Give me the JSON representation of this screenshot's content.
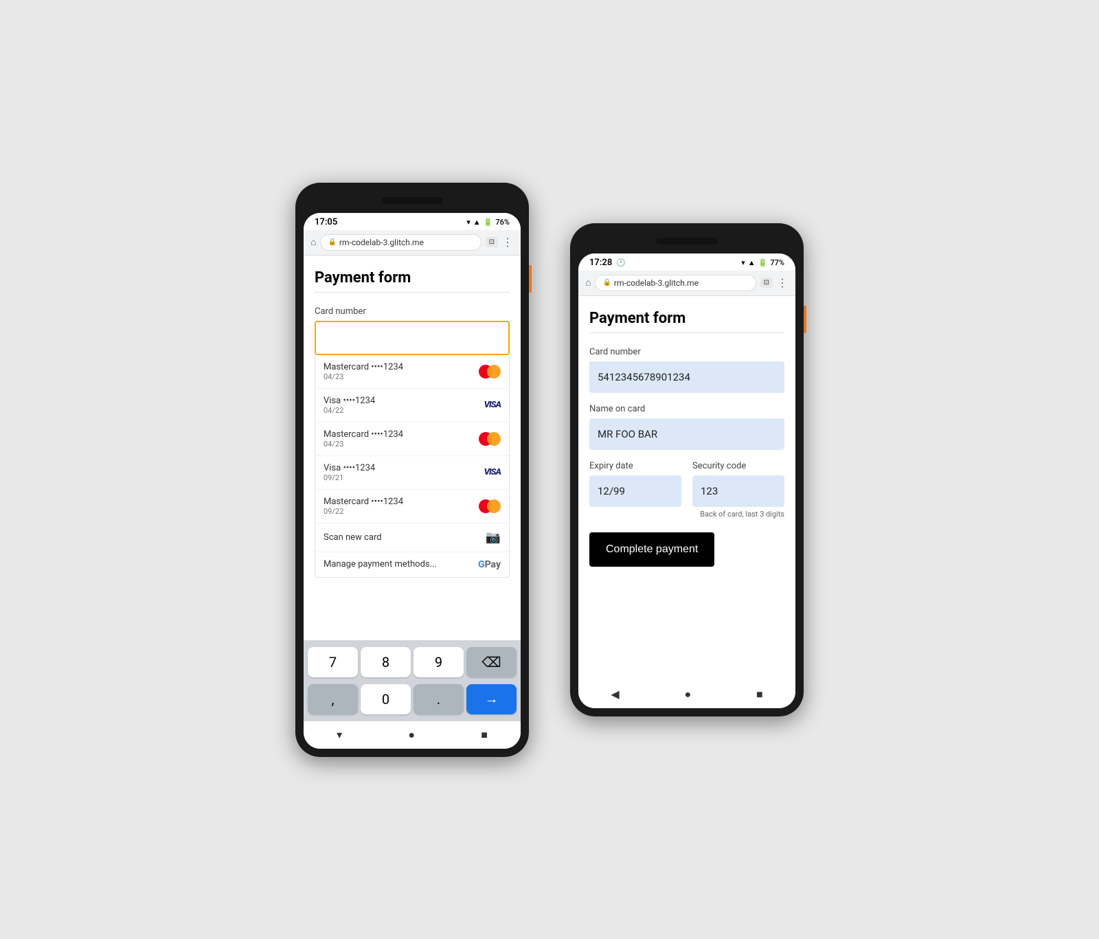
{
  "left_phone": {
    "status_bar": {
      "time": "17:05",
      "battery": "76%",
      "url": "rm-codelab-3.glitch.me"
    },
    "page": {
      "title": "Payment form",
      "card_number_label": "Card number",
      "cards": [
        {
          "name": "Mastercard ••••1234",
          "expiry": "04/23",
          "type": "mastercard"
        },
        {
          "name": "Visa ••••1234",
          "expiry": "04/22",
          "type": "visa"
        },
        {
          "name": "Mastercard ••••1234",
          "expiry": "04/23",
          "type": "mastercard"
        },
        {
          "name": "Visa ••••1234",
          "expiry": "09/21",
          "type": "visa"
        },
        {
          "name": "Mastercard ••••1234",
          "expiry": "09/22",
          "type": "mastercard"
        }
      ],
      "scan_label": "Scan new card",
      "manage_label": "Manage payment methods..."
    },
    "keyboard": {
      "keys": [
        "7",
        "8",
        "9",
        "⌫",
        ",",
        "0",
        ".",
        "→"
      ]
    }
  },
  "right_phone": {
    "status_bar": {
      "time": "17:28",
      "battery": "77%",
      "url": "rm-codelab-3.glitch.me"
    },
    "page": {
      "title": "Payment form",
      "card_number_label": "Card number",
      "card_number_value": "5412345678901234",
      "name_label": "Name on card",
      "name_value": "MR FOO BAR",
      "expiry_label": "Expiry date",
      "expiry_value": "12/99",
      "security_label": "Security code",
      "security_value": "123",
      "security_hint": "Back of card, last 3 digits",
      "complete_button": "Complete payment"
    }
  }
}
